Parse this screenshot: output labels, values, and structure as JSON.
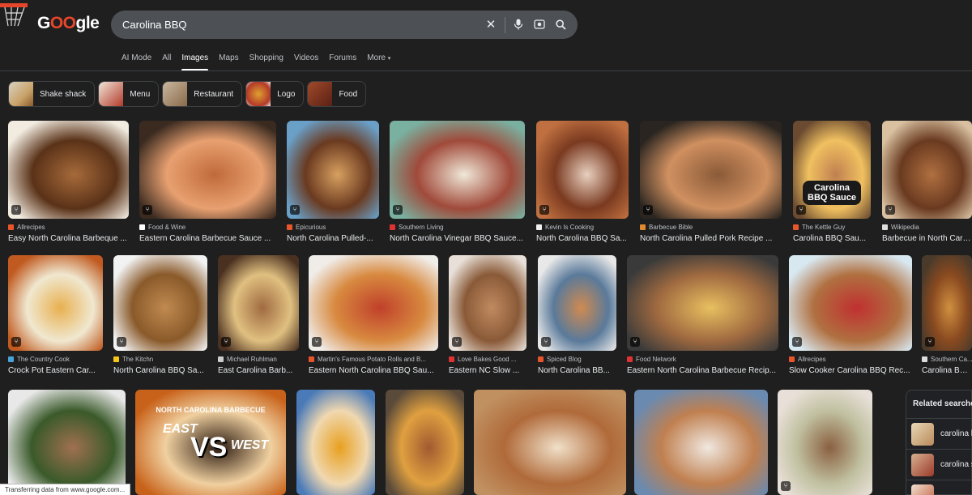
{
  "logo": {
    "prefix": "G",
    "mid": "OO",
    "suffix": "gle"
  },
  "search": {
    "query": "Carolina BBQ",
    "clear_icon": "close-icon",
    "mic_icon": "mic-icon",
    "lens_icon": "lens-icon",
    "search_icon": "search-icon"
  },
  "tabs": [
    {
      "label": "AI Mode"
    },
    {
      "label": "All"
    },
    {
      "label": "Images",
      "active": true
    },
    {
      "label": "Maps"
    },
    {
      "label": "Shopping"
    },
    {
      "label": "Videos"
    },
    {
      "label": "Forums"
    },
    {
      "label": "More"
    }
  ],
  "chips": [
    {
      "label": "Shake shack",
      "color": "#c9a36a"
    },
    {
      "label": "Menu",
      "color": "#b33a2a"
    },
    {
      "label": "Restaurant",
      "color": "#8a6a4a"
    },
    {
      "label": "Logo",
      "color": "#e0a030"
    },
    {
      "label": "Food",
      "color": "#7a3020"
    }
  ],
  "results": [
    {
      "source": "Allrecipes",
      "title": "Easy North Carolina Barbeque ...",
      "icon_color": "#e8552b"
    },
    {
      "source": "Food & Wine",
      "title": "Eastern Carolina Barbecue Sauce ...",
      "icon_color": "#ffffff"
    },
    {
      "source": "Epicurious",
      "title": "North Carolina Pulled-...",
      "icon_color": "#e8552b"
    },
    {
      "source": "Southern Living",
      "title": "North Carolina Vinegar BBQ Sauce...",
      "icon_color": "#d33"
    },
    {
      "source": "Kevin Is Cooking",
      "title": "North Carolina BBQ Sa...",
      "icon_color": "#f0f0f0"
    },
    {
      "source": "Barbecue Bible",
      "title": "North Carolina Pulled Pork Recipe ...",
      "icon_color": "#e08a30"
    },
    {
      "source": "The Kettle Guy",
      "title": "Carolina BBQ Sau...",
      "icon_color": "#e8552b"
    },
    {
      "source": "Wikipedia",
      "title": "Barbecue in North Carolin...",
      "icon_color": "#ddd"
    },
    {
      "source": "The Country Cook",
      "title": "Crock Pot Eastern Car...",
      "icon_color": "#4aa3d8"
    },
    {
      "source": "The Kitchn",
      "title": "North Carolina BBQ Sa...",
      "icon_color": "#f5c518"
    },
    {
      "source": "Michael Ruhlman",
      "title": "East Carolina Barb...",
      "icon_color": "#ccc"
    },
    {
      "source": "Martin's Famous Potato Rolls and B...",
      "title": "Eastern North Carolina BBQ Sau...",
      "icon_color": "#e8552b"
    },
    {
      "source": "Love Bakes Good ...",
      "title": "Eastern NC Slow ...",
      "icon_color": "#d33"
    },
    {
      "source": "Spiced Blog",
      "title": "North Carolina BB...",
      "icon_color": "#e8552b"
    },
    {
      "source": "Food Network",
      "title": "Eastern North Carolina Barbecue Recip...",
      "icon_color": "#d33"
    },
    {
      "source": "Allrecipes",
      "title": "Slow Cooker Carolina BBQ Rec...",
      "icon_color": "#e8552b"
    },
    {
      "source": "Southern Ca...",
      "title": "Carolina Barb...",
      "icon_color": "#ddd"
    },
    {
      "source": "",
      "title": ""
    },
    {
      "source": "",
      "title": ""
    },
    {
      "source": "",
      "title": ""
    },
    {
      "source": "",
      "title": ""
    },
    {
      "source": "",
      "title": ""
    },
    {
      "source": "",
      "title": ""
    },
    {
      "source": "",
      "title": ""
    }
  ],
  "overlay_texts": {
    "kettle": "Carolina BBQ Sauce",
    "banner_head": "NORTH CAROLINA BARBECUE",
    "east": "EAST",
    "vs": "VS",
    "west": "WEST"
  },
  "related": {
    "heading": "Related searches",
    "items": [
      {
        "label": "carolina b",
        "color": "#b98a5a"
      },
      {
        "label": "carolina s",
        "color": "#9a3a2a"
      },
      {
        "label": "",
        "color": "#c05a3a"
      }
    ]
  },
  "status": "Transferring data from www.google.com..."
}
